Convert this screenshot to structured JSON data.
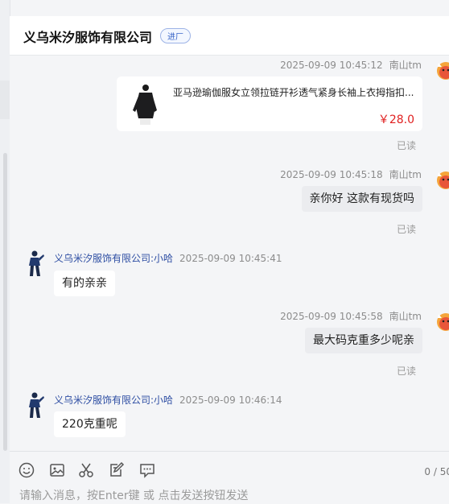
{
  "header": {
    "title": "义乌米汐服饰有限公司",
    "tag": "进厂"
  },
  "messages": [
    {
      "time": "2025-09-09 10:45:12",
      "sender": "南山tm",
      "product": {
        "title": "亚马逊瑜伽服女立领拉链开衫透气紧身长袖上衣拇指扣...",
        "price": "￥28.0"
      },
      "status": "已读"
    },
    {
      "time": "2025-09-09 10:45:18",
      "sender": "南山tm",
      "text": "亲你好 这款有现货吗",
      "status": "已读"
    },
    {
      "time": "2025-09-09 10:45:41",
      "sender": "义乌米汐服饰有限公司:小哈",
      "text": "有的亲亲"
    },
    {
      "time": "2025-09-09 10:45:58",
      "sender": "南山tm",
      "text": "最大码克重多少呢亲",
      "status": "已读"
    },
    {
      "time": "2025-09-09 10:46:14",
      "sender": "义乌米汐服饰有限公司:小哈",
      "text": "220克重呢"
    }
  ],
  "composer": {
    "tools": [
      "emoji-icon",
      "image-icon",
      "scissors-icon",
      "edit-icon",
      "quick-reply-icon"
    ],
    "counter": "0 / 50",
    "placeholder": "请输入消息，按Enter键 或 点击发送按钮发送"
  },
  "colors": {
    "accent": "#2e4ea3",
    "price": "#e02020",
    "bubble_self": "#ebecef",
    "bubble_other": "#ffffff"
  }
}
